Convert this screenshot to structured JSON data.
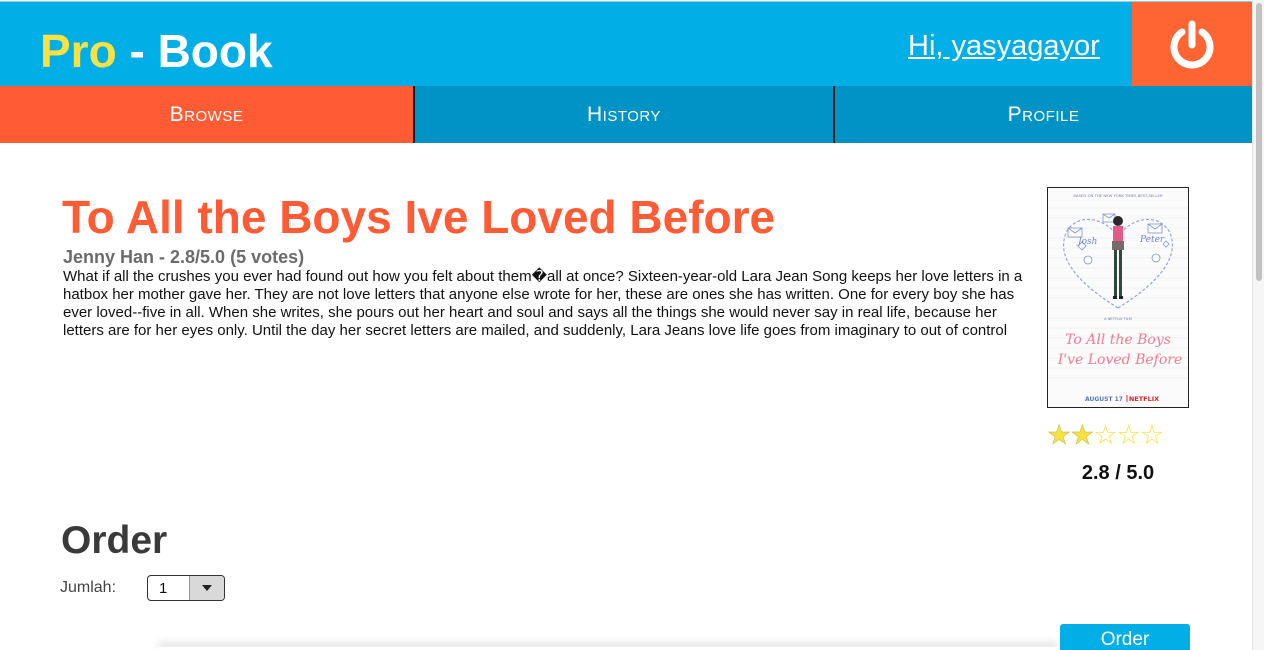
{
  "header": {
    "logo_pro": "Pro",
    "logo_rest": " - Book",
    "greeting": "Hi, yasyagayor",
    "logout_icon": "power-icon"
  },
  "nav": {
    "tabs": [
      {
        "label": "Browse",
        "active": true
      },
      {
        "label": "History",
        "active": false
      },
      {
        "label": "Profile",
        "active": false
      }
    ]
  },
  "book": {
    "title": "To All the Boys Ive Loved Before",
    "meta": "Jenny Han - 2.8/5.0 (5 votes)",
    "description": "What if all the crushes you ever had found out how you felt about them�all at once? Sixteen-year-old Lara Jean Song keeps her love letters in a hatbox her mother gave her. They are not love letters that anyone else wrote for her, these are ones she has written. One for every boy she has ever loved--five in all. When she writes, she pours out her heart and soul and says all the things she would never say in real life, because her letters are for her eyes only. Until the day her secret letters are mailed, and suddenly, Lara Jeans love life goes from imaginary to out of control",
    "rating_value": 2.8,
    "rating_max": 5,
    "rating_text": "2.8 / 5.0",
    "stars_filled": 2,
    "cover": {
      "top_line": "BASED ON THE NEW YORK TIMES BEST-SELLER",
      "studio": "A NETFLIX FILM",
      "title_line1": "To All the Boys",
      "title_line2": "I've Loved Before",
      "date": "AUGUST 17",
      "brand": "NETFLIX"
    }
  },
  "order": {
    "title": "Order",
    "qty_label": "Jumlah:",
    "qty_value": "1",
    "button_label": "Order"
  },
  "colors": {
    "header_bg": "#01aee6",
    "accent": "#ff5c35",
    "logo_yellow": "#f7e144",
    "nav_bg": "#0293c6"
  }
}
